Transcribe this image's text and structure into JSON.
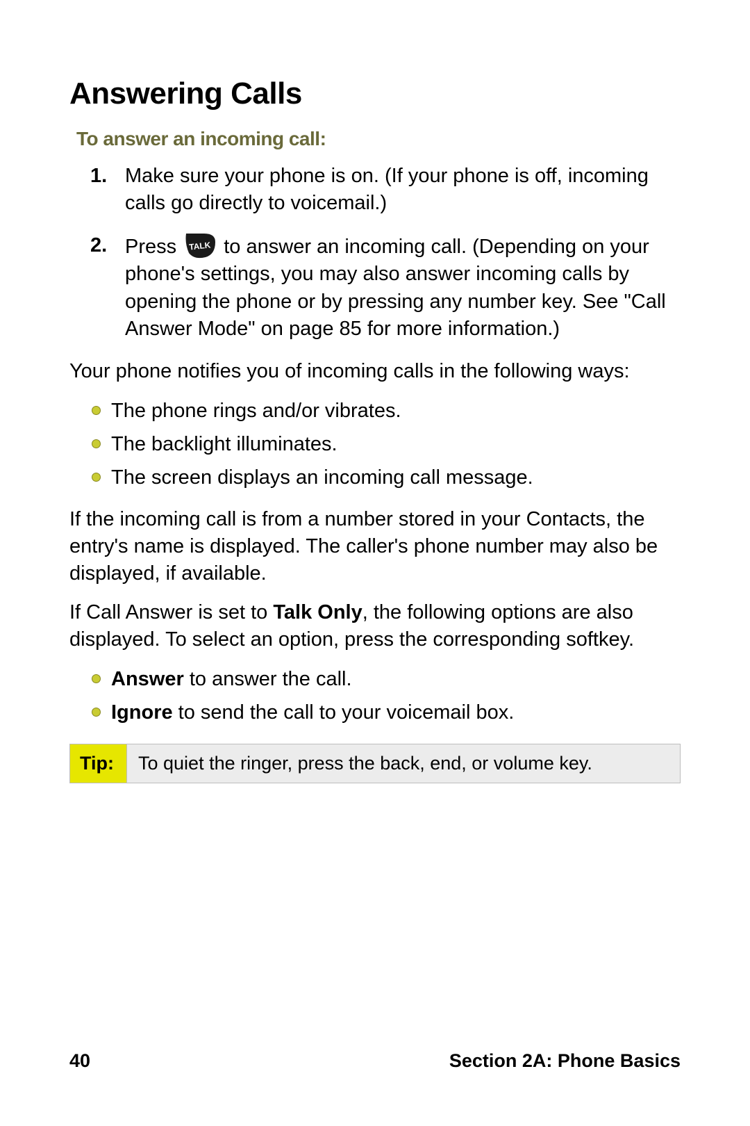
{
  "title": "Answering Calls",
  "subhead": "To answer an incoming call:",
  "steps": {
    "item1": {
      "num": "1.",
      "text": "Make sure your phone is on. (If your phone is off, incoming calls go directly to voicemail.)"
    },
    "item2": {
      "num": "2.",
      "before": "Press ",
      "after": " to answer an incoming call. (Depending on your phone's settings, you may also answer incoming calls by opening the phone or by pressing any number key. See \"Call Answer Mode\" on page 85 for more information.)"
    }
  },
  "notify_intro": "Your phone notifies you of incoming calls in the following ways:",
  "notify_bullets": {
    "b1": "The phone rings and/or vibrates.",
    "b2": "The backlight illuminates.",
    "b3": "The screen displays an incoming call message."
  },
  "contacts_para": "If the incoming call is from a number stored in your Contacts, the entry's name is displayed. The caller's phone number may also be displayed, if available.",
  "talkonly_before": "If Call Answer is set to ",
  "talkonly_bold": "Talk Only",
  "talkonly_after": ", the following options are also displayed. To select an option, press the corresponding softkey.",
  "options": {
    "answer_bold": "Answer",
    "answer_rest": " to answer the call.",
    "ignore_bold": "Ignore",
    "ignore_rest": " to send the call to your voicemail box."
  },
  "tip": {
    "label": "Tip:",
    "text": "To quiet the ringer, press the back, end, or volume key."
  },
  "footer": {
    "page": "40",
    "section": "Section 2A: Phone Basics"
  },
  "icons": {
    "talk_key": "talk-key-icon"
  }
}
